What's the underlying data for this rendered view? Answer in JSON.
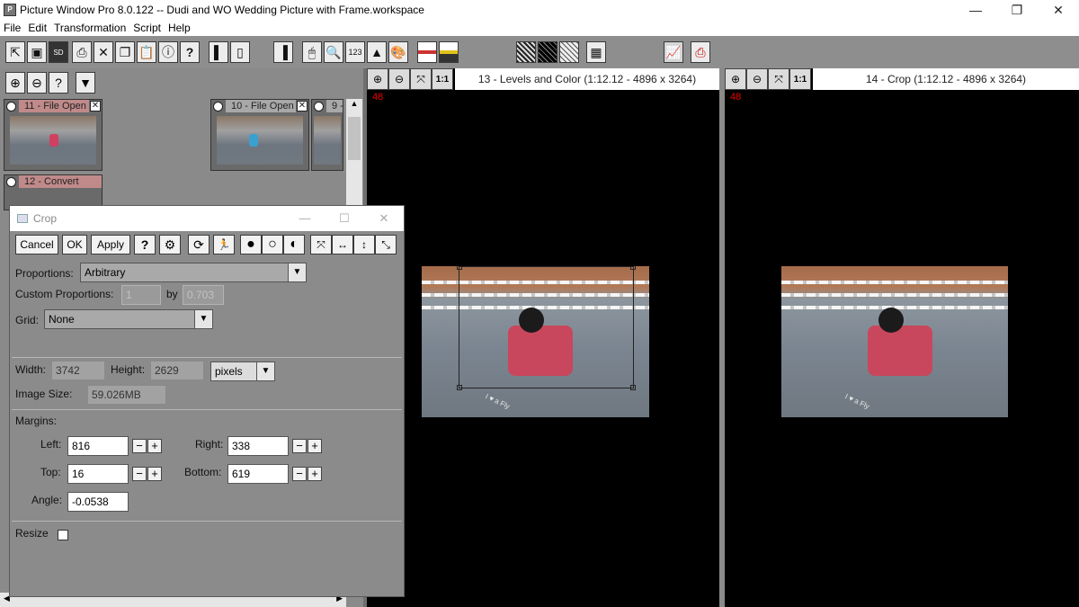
{
  "window": {
    "title": "Picture Window Pro 8.0.122  --  Dudi and WO Wedding Picture with Frame.workspace",
    "controls": [
      "—",
      "❐",
      "✕"
    ]
  },
  "menu": [
    "File",
    "Edit",
    "Transformation",
    "Script",
    "Help"
  ],
  "toolbar": {
    "icons": [
      "open-icon",
      "save-icon",
      "sd-card-icon",
      "print-icon",
      "close-icon",
      "copy-icon",
      "paste-icon",
      "info-icon",
      "help-icon",
      "panel-left-icon",
      "panel-full-icon",
      "panel-right-icon",
      "mouse-icon",
      "magnifier-icon",
      "numbers-icon",
      "histogram-icon",
      "palette-icon",
      "color-swatch-icon",
      "color-swatch-yellow-icon",
      "hatch-icon",
      "hatch-dark-icon",
      "hatch-light-icon",
      "grid-icon",
      "graph-icon",
      "printer-red-icon"
    ],
    "sd_label": "SD",
    "numbers_label": "123"
  },
  "thumbnails": [
    {
      "label": "11 - File Open",
      "active": true
    },
    {
      "label": "10 - File Open",
      "active": false
    },
    {
      "label": "9 -",
      "active": false
    },
    {
      "label": "12 - Convert",
      "active": true
    }
  ],
  "left_panel_tools": [
    "zoom-in-icon",
    "zoom-out-icon",
    "help-icon",
    "dropdown-arrow-icon"
  ],
  "panels": [
    {
      "title": "13 - Levels and Color (1:12.12 - 4896 x 3264)",
      "zoom_badge": "48",
      "zoom_1to1": "1:1"
    },
    {
      "title": "14 - Crop (1:12.12 - 4896 x 3264)",
      "zoom_badge": "48",
      "zoom_1to1": "1:1"
    }
  ],
  "photo_text": "I ♥ a Fly",
  "crop_dialog": {
    "title": "Crop",
    "buttons": {
      "cancel": "Cancel",
      "ok": "OK",
      "apply": "Apply",
      "help": "?"
    },
    "proportions_label": "Proportions:",
    "proportions_value": "Arbitrary",
    "custom_proportions_label": "Custom Proportions:",
    "custom_a": "1",
    "by_label": "by",
    "custom_b": "0.703",
    "grid_label": "Grid:",
    "grid_value": "None",
    "width_label": "Width:",
    "width_value": "3742",
    "height_label": "Height:",
    "height_value": "2629",
    "units_value": "pixels",
    "image_size_label": "Image Size:",
    "image_size_value": "59.026MB",
    "margins_label": "Margins:",
    "left_label": "Left:",
    "left_value": "816",
    "right_label": "Right:",
    "right_value": "338",
    "top_label": "Top:",
    "top_value": "16",
    "bottom_label": "Bottom:",
    "bottom_value": "619",
    "angle_label": "Angle:",
    "angle_value": "-0.0538",
    "resize_label": "Resize",
    "resize_checked": false
  }
}
